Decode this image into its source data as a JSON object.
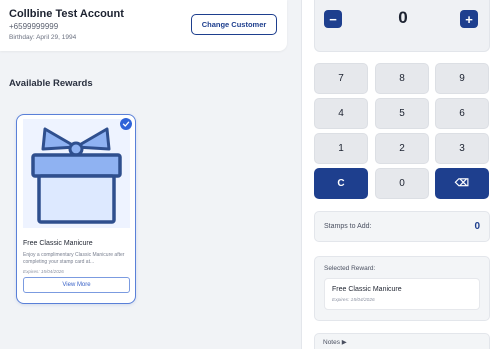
{
  "customer": {
    "name": "Collbine Test Account",
    "phone": "+6599999999",
    "birthday": "Birthday: April 29, 1994",
    "change_label": "Change Customer"
  },
  "rewards_section": {
    "title": "Available Rewards",
    "items": [
      {
        "name": "Free Classic Manicure",
        "description": "Enjoy a complimentary Classic Manicure after completing your stamp card at...",
        "expires": "Expires: 15/04/2026",
        "view_label": "View More",
        "selected": true,
        "icon": "gift-icon"
      }
    ]
  },
  "counter": {
    "minus": "−",
    "plus": "+",
    "value": "0"
  },
  "keypad": {
    "keys": [
      "7",
      "8",
      "9",
      "4",
      "5",
      "6",
      "1",
      "2",
      "3",
      "C",
      "0",
      "⌫"
    ]
  },
  "stamps": {
    "label": "Stamps to Add:",
    "value": "0"
  },
  "selected_reward": {
    "label": "Selected Reward:",
    "name": "Free Classic Manicure",
    "expires": "Expires: 15/04/2026"
  },
  "notes": {
    "label": "Notes ▶"
  },
  "colors": {
    "primary": "#1e3f8e",
    "accent": "#2f63d8",
    "background": "#f1f3f6"
  }
}
